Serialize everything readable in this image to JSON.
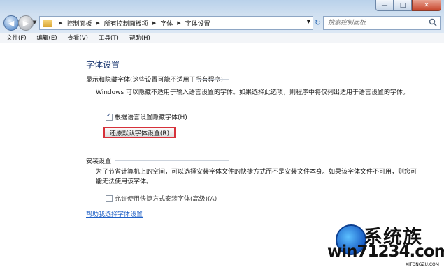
{
  "window": {
    "controls": {
      "minimize": "—",
      "maximize": "□",
      "close": "✕"
    }
  },
  "nav": {
    "back_icon": "arrow-left-icon",
    "forward_icon": "arrow-right-icon",
    "breadcrumbs": [
      "控制面板",
      "所有控制面板项",
      "字体",
      "字体设置"
    ],
    "search_placeholder": "搜索控制面板"
  },
  "menu": [
    "文件(F)",
    "编辑(E)",
    "查看(V)",
    "工具(T)",
    "帮助(H)"
  ],
  "page": {
    "title": "字体设置",
    "hide_section": {
      "heading": "显示和隐藏字体(这些设置可能不适用于所有程序)",
      "description": "Windows 可以隐藏不适用于输入语言设置的字体。如果选择此选项，则程序中将仅列出适用于语言设置的字体。",
      "checkbox_label": "根据语言设置隐藏字体(H)",
      "checkbox_checked": true,
      "restore_button": "还原默认字体设置(R)"
    },
    "install_section": {
      "heading": "安装设置",
      "description": "为了节省计算机上的空间，可以选择安装字体文件的快捷方式而不是安装文件本身。如果该字体文件不可用，则您可能无法使用该字体。",
      "checkbox_label": "允许使用快捷方式安装字体(高级)(A)",
      "checkbox_checked": false
    },
    "help_link": "帮助我选择字体设置"
  },
  "watermark": {
    "brand": "系统族",
    "url": "win71234.com",
    "sub": "XITONGZU.COM"
  },
  "colors": {
    "accent_red": "#d6313a",
    "link": "#1d5fc6",
    "title": "#1e3a72"
  }
}
